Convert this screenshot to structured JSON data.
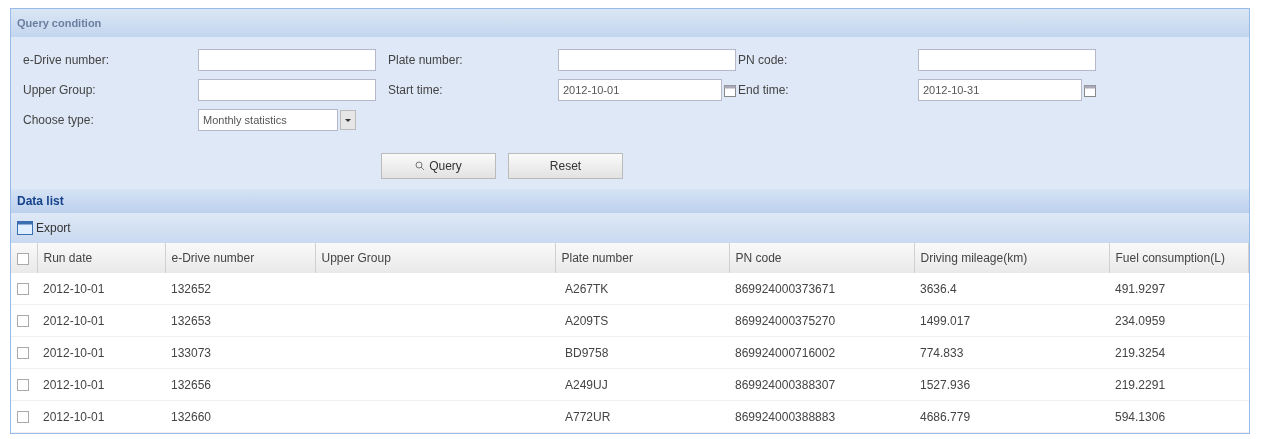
{
  "query_panel": {
    "title": "Query condition",
    "fields": [
      {
        "label": "e-Drive number:",
        "kind": "text"
      },
      {
        "label": "Plate number:",
        "kind": "text"
      },
      {
        "label": "PN code:",
        "kind": "text"
      },
      {
        "label": "Upper Group:",
        "kind": "text"
      },
      {
        "label": "Start time:",
        "kind": "date",
        "value": "2012-10-01"
      },
      {
        "label": "End time:",
        "kind": "date",
        "value": "2012-10-31"
      },
      {
        "label": "Choose type:",
        "kind": "select",
        "value": "Monthly statistics"
      }
    ],
    "buttons": [
      "Query",
      "Reset"
    ]
  },
  "data_list": {
    "title": "Data list",
    "toolbar": [
      "Export"
    ],
    "table": {
      "select_all_checked": false,
      "columns": [
        "Run date",
        "e-Drive number",
        "Upper Group",
        "Plate number",
        "PN code",
        "Driving mileage(km)",
        "Fuel consumption(L)"
      ],
      "rows": [
        {
          "checked": false,
          "cells": [
            "2012-10-01",
            "132652",
            "",
            "A267TK",
            "869924000373671",
            "3636.4",
            "491.9297"
          ]
        },
        {
          "checked": false,
          "cells": [
            "2012-10-01",
            "132653",
            "",
            "A209TS",
            "869924000375270",
            "1499.017",
            "234.0959"
          ]
        },
        {
          "checked": false,
          "cells": [
            "2012-10-01",
            "133073",
            "",
            "BD9758",
            "869924000716002",
            "774.833",
            "219.3254"
          ]
        },
        {
          "checked": false,
          "cells": [
            "2012-10-01",
            "132656",
            "",
            "A249UJ",
            "869924000388307",
            "1527.936",
            "219.2291"
          ]
        },
        {
          "checked": false,
          "cells": [
            "2012-10-01",
            "132660",
            "",
            "A772UR",
            "869924000388883",
            "4686.779",
            "594.1306"
          ]
        }
      ]
    }
  }
}
